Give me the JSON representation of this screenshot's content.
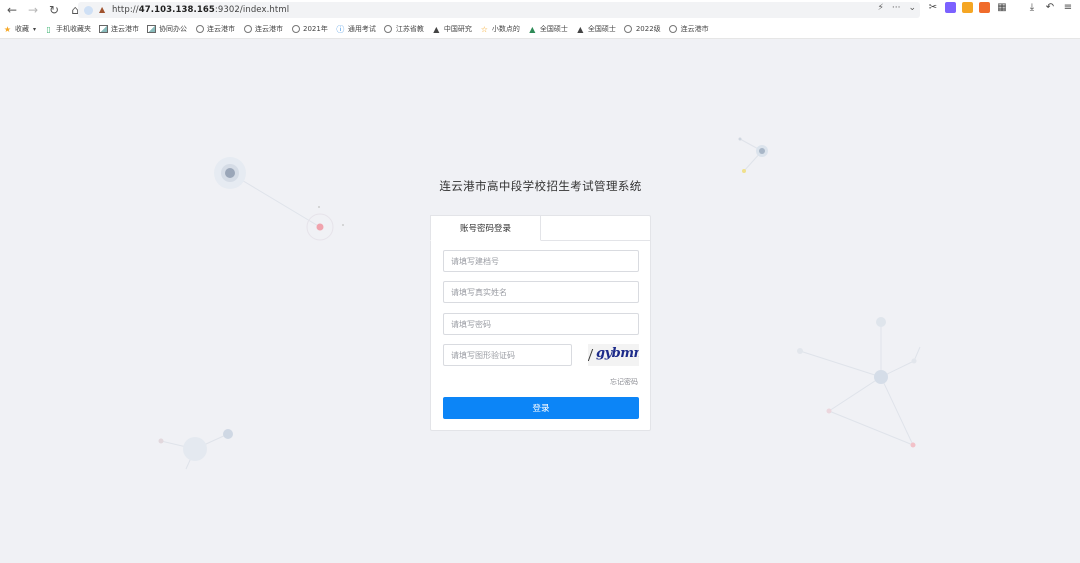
{
  "browser": {
    "url_prefix": "http://",
    "url_host": "47.103.138.165",
    "url_rest": ":9302/index.html",
    "bookmarks": [
      {
        "label": "收藏",
        "icon": "star-icon",
        "color": "#f5a623"
      },
      {
        "label": "手机收藏夹",
        "icon": "phone-icon",
        "color": "#3cb371"
      },
      {
        "label": "连云港市",
        "icon": "image-icon"
      },
      {
        "label": "协同办公",
        "icon": "image-icon"
      },
      {
        "label": "连云港市",
        "icon": "globe-icon"
      },
      {
        "label": "连云港市",
        "icon": "globe-icon"
      },
      {
        "label": "2021年",
        "icon": "globe-icon"
      },
      {
        "label": "通用考试",
        "icon": "info-icon"
      },
      {
        "label": "江苏省教",
        "icon": "globe-icon"
      },
      {
        "label": "中国研究",
        "icon": "cap-icon"
      },
      {
        "label": "小数点的",
        "icon": "star-outline-icon"
      },
      {
        "label": "全国硕士",
        "icon": "mountain-icon"
      },
      {
        "label": "全国硕士",
        "icon": "cap-icon"
      },
      {
        "label": "2022级",
        "icon": "globe-icon"
      },
      {
        "label": "连云港市",
        "icon": "globe-icon"
      }
    ]
  },
  "page": {
    "title": "连云港市高中段学校招生考试管理系统",
    "tab_label": "账号密码登录",
    "fields": {
      "file_no_placeholder": "请填写建档号",
      "name_placeholder": "请填写真实姓名",
      "password_placeholder": "请填写密码",
      "captcha_placeholder": "请填写图形验证码"
    },
    "captcha_text": "gybmn",
    "forgot_label": "忘记密码",
    "login_label": "登录",
    "accent_color": "#0c85f7"
  }
}
